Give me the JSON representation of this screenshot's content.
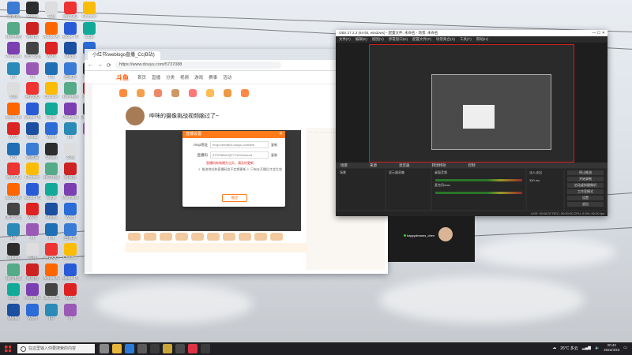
{
  "browser": {
    "tab_title": "小红书/weblogo直播_Cc(B站)",
    "url": "https://www.douyu.com/5737088",
    "site_logo": "斗鱼",
    "site_nav": [
      "首页",
      "直播",
      "分类",
      "视频",
      "游戏",
      "赛事",
      "活动"
    ],
    "room_title": "哔咪的摄像挑战视频脑过了~"
  },
  "dialog": {
    "title": "直播设置",
    "row1_label": "rtmp地址",
    "row1_value": "rtmp://sendtc3.douyu.com/live",
    "row1_btn": "复制",
    "row2_label": "直播码",
    "row2_value": "5737088rOQFY7s0Vwcteod",
    "row2_btn": "复制",
    "warn": "直播码有效期为当天，请及时更新",
    "note": "1. 推流地址和直播码会不定期更新    2. 只有在开播后才会生效",
    "ok": "确定"
  },
  "obs": {
    "title": "OBS 27.2.3 (64-bit, windows) - 配置文件: 未命名 - 场景: 未命名",
    "menu": [
      "文件(F)",
      "编辑(E)",
      "视图(V)",
      "停靠窗口(D)",
      "配置文件(P)",
      "场景集合(S)",
      "工具(T)",
      "帮助(H)"
    ],
    "docks": [
      "场景",
      "来源",
      "混音器",
      "转场特效",
      "控制"
    ],
    "scene_item": "场景",
    "source_item": "显示器采集",
    "mixer_items": [
      "桌面音频",
      "麦克风/Aux"
    ],
    "transition_item": "淡入淡出",
    "duration": "300 ms",
    "controls": [
      "停止推流",
      "开始录制",
      "启动虚拟摄像机",
      "工作室模式",
      "设置",
      "退出"
    ],
    "status": "LIVE: 00:08:37   REC: 00:00:00   CPU: 5.3%, 60.00 fps"
  },
  "webcam": {
    "name": "happydreams_chen"
  },
  "taskbar": {
    "search_placeholder": "在这里输入你要搜索的内容",
    "weather": "26°C 多云",
    "time": "20:42",
    "date": "2022/4/23"
  },
  "desktop_icons": [
    "回收站",
    "Steam",
    "文档",
    "腾讯QQ",
    "Chrome",
    "我的电脑",
    "网易云",
    "Adobe AI",
    "Adobe PS",
    "Edge",
    "Premiere",
    "OBS Studio",
    "WPS",
    "Media",
    "Word",
    "LR",
    "Pl",
    "PS"
  ]
}
